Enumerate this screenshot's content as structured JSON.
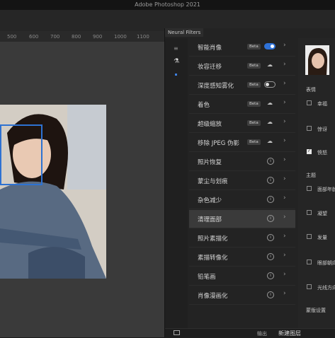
{
  "app": {
    "title": "Adobe Photoshop 2021"
  },
  "ruler": {
    "ticks": [
      "500",
      "600",
      "700",
      "800",
      "900",
      "1000",
      "1100"
    ]
  },
  "panel": {
    "title": "Neural Filters",
    "filters": [
      {
        "label": "智能肖像",
        "badge": "Beta",
        "state": "toggle-on",
        "active": false
      },
      {
        "label": "妆容迁移",
        "badge": "Beta",
        "state": "cloud",
        "active": false
      },
      {
        "label": "深度感知雾化",
        "badge": "Beta",
        "state": "toggle-off",
        "active": false
      },
      {
        "label": "着色",
        "badge": "Beta",
        "state": "cloud",
        "active": false
      },
      {
        "label": "超级缩放",
        "badge": "Beta",
        "state": "cloud",
        "active": false
      },
      {
        "label": "移除 JPEG 伪影",
        "badge": "Beta",
        "state": "cloud",
        "active": false
      },
      {
        "label": "照片恢复",
        "badge": "",
        "state": "info",
        "active": false
      },
      {
        "label": "蒙尘与划痕",
        "badge": "",
        "state": "info",
        "active": false
      },
      {
        "label": "杂色减少",
        "badge": "",
        "state": "info",
        "active": false
      },
      {
        "label": "清理面部",
        "badge": "",
        "state": "info",
        "active": true
      },
      {
        "label": "照片素描化",
        "badge": "",
        "state": "info",
        "active": false
      },
      {
        "label": "素描转像化",
        "badge": "",
        "state": "info",
        "active": false
      },
      {
        "label": "铅笔画",
        "badge": "",
        "state": "info",
        "active": false
      },
      {
        "label": "肖像漫画化",
        "badge": "",
        "state": "info",
        "active": false
      }
    ],
    "settings": {
      "expression_title": "表情",
      "expression_options": [
        {
          "label": "幸福",
          "checked": false
        },
        {
          "label": "惊讶",
          "checked": false
        },
        {
          "label": "愤怒",
          "checked": true
        }
      ],
      "theme_title": "主题",
      "theme_options": [
        {
          "label": "面部年龄",
          "checked": false
        },
        {
          "label": "凝望",
          "checked": false
        },
        {
          "label": "发量",
          "checked": false
        },
        {
          "label": "眼部朝向",
          "checked": false
        },
        {
          "label": "光线方向",
          "checked": false
        }
      ],
      "more_title": "蒙版设置"
    },
    "footer": {
      "output_label": "输出",
      "output_value": "新建图层"
    }
  }
}
